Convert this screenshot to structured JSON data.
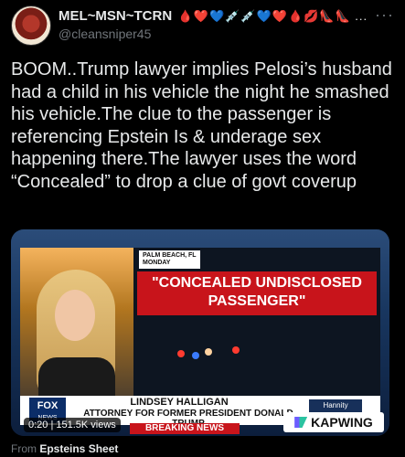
{
  "author": {
    "display_name": "MEL~MSN~TCRN",
    "emoji_suffix": "🩸❤️💙💉💉💙❤️🩸💋👠👠 ...",
    "handle": "@cleansniper45"
  },
  "tweet": {
    "text": "BOOM..Trump lawyer implies Pelosi’s husband had a child in his vehicle the night he smashed his vehicle.The clue to the passenger is referencing Epstein Is & underage sex happening there.The lawyer uses the word “Concealed” to drop a clue of govt coverup"
  },
  "media": {
    "location_tag": "PALM BEACH, FL\nMONDAY",
    "headline": "\"CONCEALED UNDISCLOSED PASSENGER\"",
    "lower_third_name": "LINDSEY HALLIGAN",
    "lower_third_title": "ATTORNEY FOR FORMER PRESIDENT DONALD TRUMP",
    "breaking_label": "BREAKING NEWS",
    "network_logo": "FOX",
    "network_tag": "NEWS",
    "show_tag": "Hannity",
    "video_time_views": "0:20 | 151.5K views",
    "watermark": "KAPWING"
  },
  "footer": {
    "from_label": "From",
    "source_name": "Epsteins Sheet"
  }
}
